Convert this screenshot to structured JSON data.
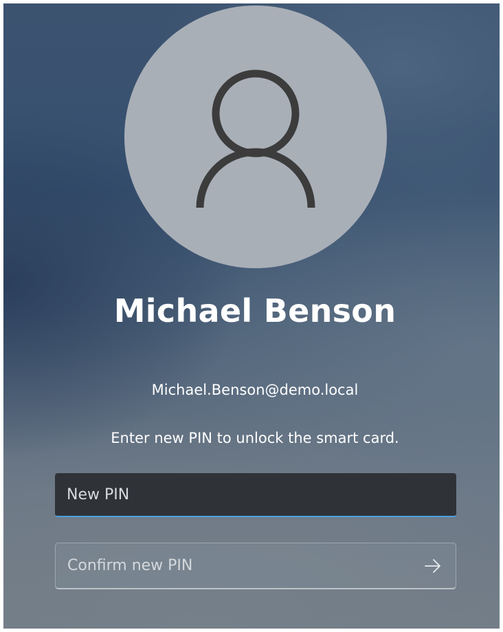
{
  "user": {
    "avatar_icon": "person-icon",
    "name": "Michael Benson",
    "email": "Michael.Benson@demo.local"
  },
  "prompt": {
    "instruction": "Enter new PIN to unlock the smart card."
  },
  "fields": {
    "new_pin": {
      "placeholder": "New PIN",
      "value": ""
    },
    "confirm_pin": {
      "placeholder": "Confirm new PIN",
      "value": ""
    }
  },
  "submit": {
    "icon": "arrow-right-icon"
  },
  "colors": {
    "accent_underline": "#4ca0e0",
    "avatar_background": "#a9afb7",
    "avatar_glyph": "#3c3c3c",
    "active_field_background": "#2f3338"
  }
}
